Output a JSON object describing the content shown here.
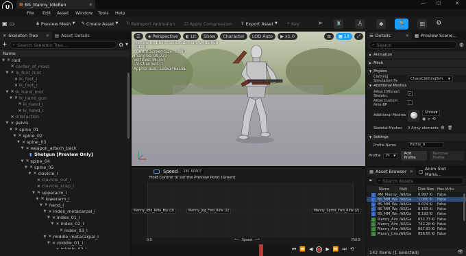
{
  "colors": {
    "accent": "#1a9fff",
    "selection": "#2a4b78",
    "play_red": "#b73737",
    "asset_green": "#3e8e3e"
  },
  "tab": {
    "title": "BS_Manny_IdleRun"
  },
  "menu": [
    "File",
    "Edit",
    "Asset",
    "Window",
    "Tools",
    "Help"
  ],
  "toolbar": {
    "preview_mesh": "Preview Mesh",
    "create_asset": "Create Asset",
    "reimport": "Reimport Animation",
    "apply_compression": "Apply Compression",
    "export_asset": "Export Asset",
    "key": "Key"
  },
  "skeleton_panel": {
    "tab_tree": "Skeleton Tree",
    "tab_details": "Asset Details",
    "search_placeholder": "Search Skeleton Tree...",
    "header_name": "Name",
    "rows": [
      {
        "label": "root",
        "depth": 0,
        "caret": true,
        "dim": false
      },
      {
        "label": "center_of_mass",
        "depth": 1,
        "caret": false,
        "dim": true
      },
      {
        "label": "ik_foot_root",
        "depth": 1,
        "caret": true,
        "dim": true
      },
      {
        "label": "ik_foot_l",
        "depth": 2,
        "caret": false,
        "dim": true
      },
      {
        "label": "ik_foot_r",
        "depth": 2,
        "caret": false,
        "dim": true
      },
      {
        "label": "ik_hand_root",
        "depth": 1,
        "caret": true,
        "dim": true
      },
      {
        "label": "ik_hand_gun",
        "depth": 2,
        "caret": true,
        "dim": true
      },
      {
        "label": "ik_hand_l",
        "depth": 3,
        "caret": false,
        "dim": true
      },
      {
        "label": "ik_hand_r",
        "depth": 3,
        "caret": false,
        "dim": true
      },
      {
        "label": "interaction",
        "depth": 1,
        "caret": false,
        "dim": true
      },
      {
        "label": "pelvis",
        "depth": 1,
        "caret": true,
        "dim": false
      },
      {
        "label": "spine_01",
        "depth": 2,
        "caret": true,
        "dim": false
      },
      {
        "label": "spine_02",
        "depth": 3,
        "caret": true,
        "dim": false
      },
      {
        "label": "spine_03",
        "depth": 4,
        "caret": true,
        "dim": false
      },
      {
        "label": "weapon_attach_back",
        "depth": 5,
        "caret": true,
        "dim": false
      },
      {
        "label": "Shotgun [Preview Only]",
        "depth": 6,
        "caret": false,
        "dim": false,
        "preview": true
      },
      {
        "label": "spine_04",
        "depth": 5,
        "caret": true,
        "dim": false
      },
      {
        "label": "spine_05",
        "depth": 6,
        "caret": true,
        "dim": false
      },
      {
        "label": "clavicle_l",
        "depth": 7,
        "caret": true,
        "dim": false
      },
      {
        "label": "clavicle_out_l",
        "depth": 8,
        "caret": false,
        "dim": true
      },
      {
        "label": "clavicle_scap_l",
        "depth": 8,
        "caret": false,
        "dim": true
      },
      {
        "label": "upperarm_l",
        "depth": 8,
        "caret": true,
        "dim": false
      },
      {
        "label": "lowerarm_l",
        "depth": 9,
        "caret": true,
        "dim": false
      },
      {
        "label": "hand_l",
        "depth": 10,
        "caret": true,
        "dim": false
      },
      {
        "label": "index_metacarpal_l",
        "depth": 11,
        "caret": true,
        "dim": false
      },
      {
        "label": "index_01_l",
        "depth": 12,
        "caret": true,
        "dim": false
      },
      {
        "label": "index_02_l",
        "depth": 13,
        "caret": true,
        "dim": false
      },
      {
        "label": "index_03_l",
        "depth": 14,
        "caret": false,
        "dim": false
      },
      {
        "label": "middle_metacarpal_l",
        "depth": 11,
        "caret": true,
        "dim": false
      },
      {
        "label": "middle_01_l",
        "depth": 12,
        "caret": true,
        "dim": false
      },
      {
        "label": "middle_02_l",
        "depth": 13,
        "caret": false,
        "dim": false
      }
    ]
  },
  "viewport": {
    "perspective": "Perspective",
    "lit": "Lit",
    "show": "Show",
    "character": "Character",
    "lod": "LOD Auto",
    "speed": "x1.0",
    "fov": "10",
    "hud": [
      "Previewing Blend Space BS_Manny_IdleRun",
      "LOD: 0",
      "Current Screen Size: 1.000",
      "Triangles: 99,722",
      "Vertices: 48,757",
      "UV Channels: 1",
      "Approx Size: 128x146x181"
    ]
  },
  "blendspace": {
    "axis_label": "Speed",
    "axis_value": "281.60907",
    "hint": "Hold Control to set the Preview Point (Green)",
    "samples": [
      "Manny_Idle_Rifle_Hip (0)",
      "Manny_Jog_Fwd_Rifle (1)",
      "Manny_Sprint_Fwd_Rifle (2)"
    ],
    "axis_min": "0.0",
    "axis_max": "750.0",
    "axis_name": "Speed"
  },
  "details": {
    "tab_details": "Details",
    "tab_preview": "Preview Scene...",
    "search_placeholder": "Search",
    "sections": [
      "Animation",
      "Mesh",
      "Physics",
      "Additional Meshes",
      "Settings"
    ],
    "clothing_label": "Clothing Simulation Fa",
    "clothing_value": "ChaosClothingSim",
    "allow_different": "Allow Different Skeleto",
    "allow_custom": "Allow Custom AnimBP",
    "additional_meshes": "Additional Meshes",
    "unreal_label": "Unrea",
    "skeletal_meshes": "Skeletal Meshes",
    "array_elements": "0 Array elements",
    "profile_name_label": "Profile Name",
    "profile_name_value": "Profile_0",
    "profile_label": "Profile",
    "profile_value": "Pr",
    "add_profile": "Add Profile",
    "remove_profile": "Remove Profile"
  },
  "asset_browser": {
    "tab_browser": "Asset Browser",
    "tab_anim": "Anim Slot Mana...",
    "search_placeholder": "Search Assets",
    "columns": [
      "Name",
      "Path",
      "Disk Size",
      "Has Virtu"
    ],
    "rows": [
      {
        "name": "AM_Manny_",
        "path": "/All/Ga",
        "size": "0.997 Ki",
        "virt": "False",
        "selected": false
      },
      {
        "name": "BS_MM_Wa",
        "path": "/All/Ga",
        "size": "1.000 Ki",
        "virt": "False",
        "selected": true
      },
      {
        "name": "BS_MM_Wa",
        "path": "/All/Ga",
        "size": "9.074 Ki",
        "virt": "False",
        "selected": false
      },
      {
        "name": "BS_MM_Wa",
        "path": "/All/Ga",
        "size": "8.193 Ki",
        "virt": "False",
        "selected": false
      },
      {
        "name": "BS_MM_Wa",
        "path": "/All/Ga",
        "size": "8.193 Ki",
        "virt": "False",
        "selected": false
      },
      {
        "name": "Manny_Aim",
        "path": "/All/Ga",
        "size": "652.73 Ki",
        "virt": "False",
        "selected": false
      },
      {
        "name": "Manny_Aim",
        "path": "/All/Ga",
        "size": "742.28 Ki",
        "virt": "False",
        "selected": false
      },
      {
        "name": "Manny_Aim",
        "path": "/All/Ga",
        "size": "867.93 Ki",
        "virt": "False",
        "selected": false
      },
      {
        "name": "Manny_Crou",
        "path": "/All/Ga",
        "size": "858.55 Ki",
        "virt": "False",
        "selected": false
      }
    ],
    "status": "142 items (1 selected)"
  }
}
